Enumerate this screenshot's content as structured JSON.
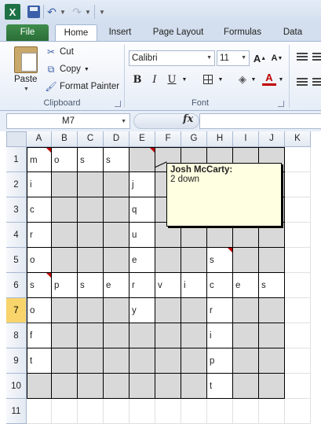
{
  "app": {
    "name": "Microsoft Excel",
    "accent": "#1e7145"
  },
  "quick_access": {
    "items": [
      "excel-logo",
      "save-icon",
      "undo-icon",
      "redo-icon",
      "customize-icon"
    ]
  },
  "tabs": [
    "File",
    "Home",
    "Insert",
    "Page Layout",
    "Formulas",
    "Data"
  ],
  "active_tab": "Home",
  "ribbon": {
    "clipboard": {
      "paste_label": "Paste",
      "cut_label": "Cut",
      "copy_label": "Copy",
      "format_painter_label": "Format Painter",
      "group_label": "Clipboard"
    },
    "font": {
      "font_name": "Calibri",
      "font_size": "11",
      "bold": "B",
      "italic": "I",
      "underline": "U",
      "grow": "A",
      "shrink": "A",
      "font_color": "A",
      "group_label": "Font"
    }
  },
  "formula_bar": {
    "name_box": "M7",
    "fx_label": "fx",
    "formula": ""
  },
  "columns": [
    "A",
    "B",
    "C",
    "D",
    "E",
    "F",
    "G",
    "H",
    "I",
    "J",
    "K"
  ],
  "rows": [
    "1",
    "2",
    "3",
    "4",
    "5",
    "6",
    "7",
    "8",
    "9",
    "10",
    "11"
  ],
  "selected_row": "7",
  "grid": {
    "row_1": [
      "m",
      "o",
      "s",
      "s",
      "",
      "",
      "",
      "",
      "",
      ""
    ],
    "row_2": [
      "i",
      "",
      "",
      "",
      "j",
      "",
      "",
      "",
      "",
      ""
    ],
    "row_3": [
      "c",
      "",
      "",
      "",
      "q",
      "",
      "",
      "",
      "",
      ""
    ],
    "row_4": [
      "r",
      "",
      "",
      "",
      "u",
      "",
      "",
      "",
      "",
      ""
    ],
    "row_5": [
      "o",
      "",
      "",
      "",
      "e",
      "",
      "",
      "s",
      "",
      ""
    ],
    "row_6": [
      "s",
      "p",
      "s",
      "e",
      "r",
      "v",
      "i",
      "c",
      "e",
      "s"
    ],
    "row_7": [
      "o",
      "",
      "",
      "",
      "y",
      "",
      "",
      "r",
      "",
      ""
    ],
    "row_8": [
      "f",
      "",
      "",
      "",
      "",
      "",
      "",
      "i",
      "",
      ""
    ],
    "row_9": [
      "t",
      "",
      "",
      "",
      "",
      "",
      "",
      "p",
      "",
      ""
    ],
    "row_10": [
      "",
      "",
      "",
      "",
      "",
      "",
      "",
      "t",
      "",
      ""
    ]
  },
  "comment": {
    "author": "Josh McCarty:",
    "text": "2 down"
  }
}
